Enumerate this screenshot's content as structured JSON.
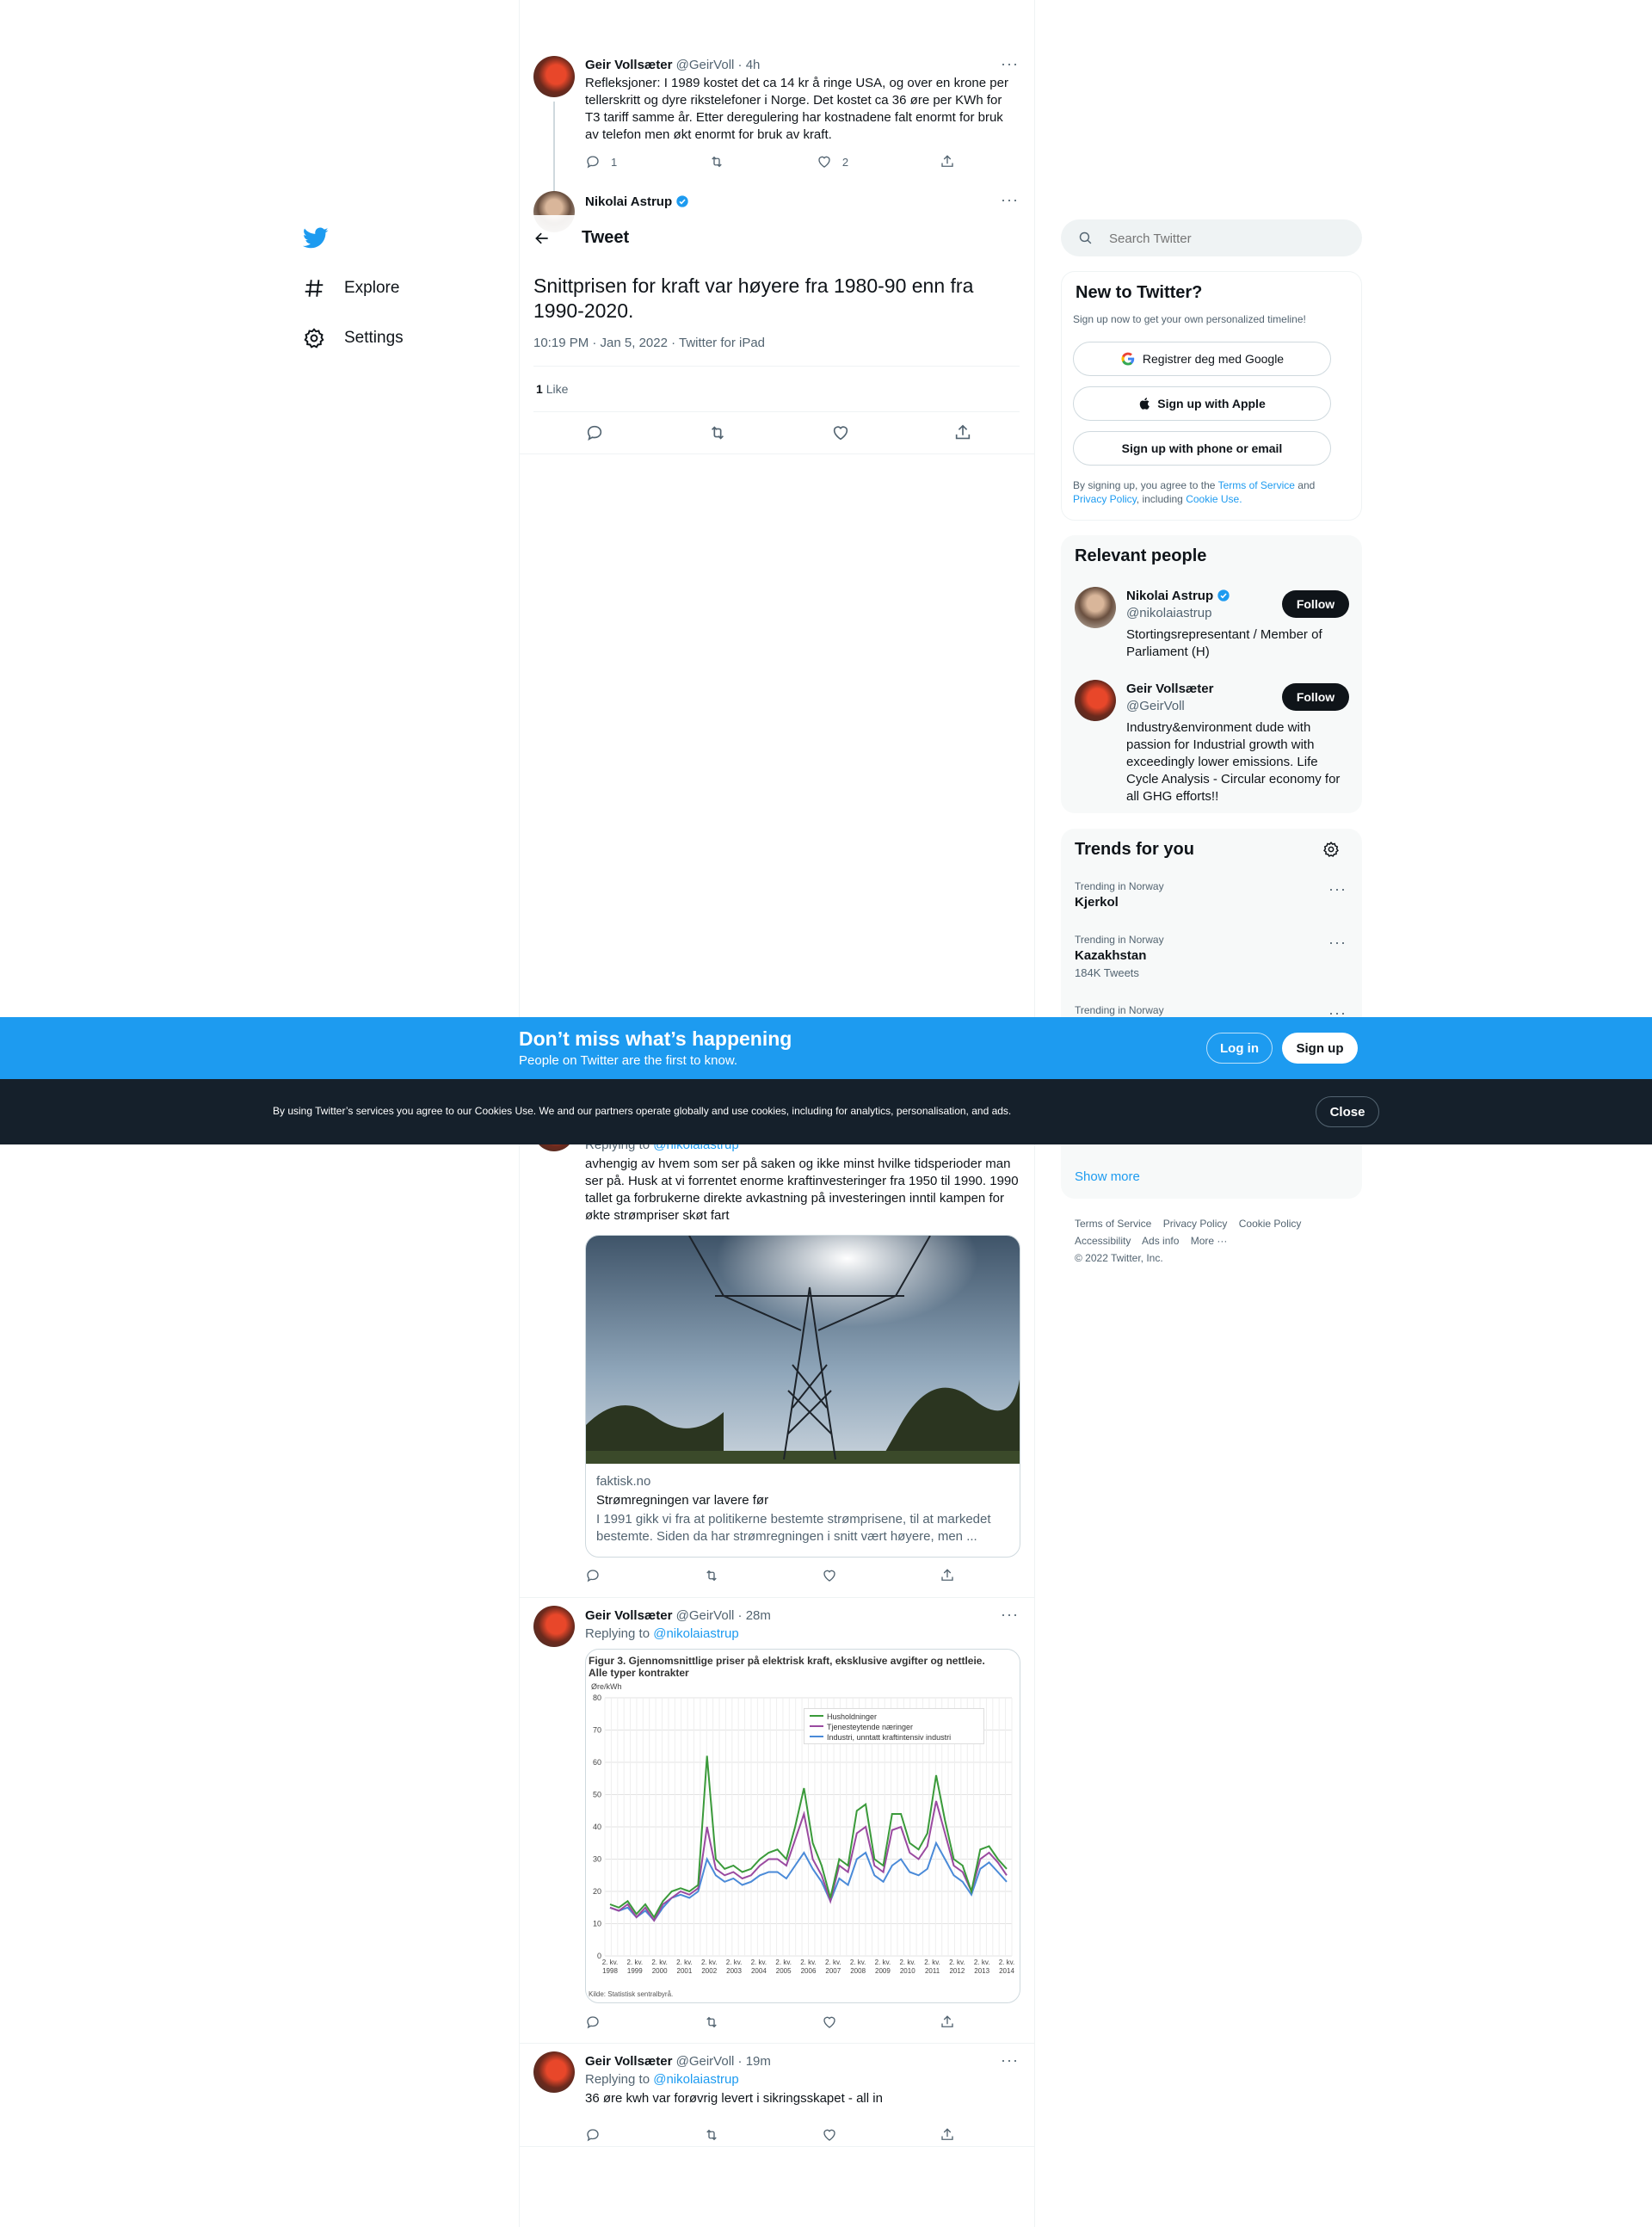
{
  "nav": {
    "explore": "Explore",
    "settings": "Settings"
  },
  "header": {
    "title": "Tweet"
  },
  "thread": {
    "parent": {
      "name": "Geir Vollsæter",
      "handle": "@GeirVoll",
      "time": "· 4h",
      "text": "Refleksjoner: I 1989 kostet det ca 14 kr å ringe USA, og over en krone per tellerskritt og dyre rikstelefoner i Norge. Det kostet ca 36 øre per KWh for T3 tariff samme år.  Etter deregulering har kostnadene falt enormt for bruk av telefon men økt enormt for bruk av kraft.",
      "replies": "1",
      "likes": "2"
    },
    "main": {
      "name": "Nikolai Astrup",
      "text": "Snittprisen for kraft var høyere fra 1980-90 enn fra 1990-2020.",
      "meta": "10:19 PM · Jan 5, 2022 · Twitter for iPad",
      "likes_count": "1",
      "likes_label": "Like"
    }
  },
  "replies": [
    {
      "reply_to_label": "Replying to",
      "reply_to": "@nikolaiastrup",
      "text": "avhengig av hvem som ser på saken og ikke minst hvilke tidsperioder man ser på. Husk at vi forrentet enorme kraftinvesteringer fra 1950 til 1990. 1990 tallet ga forbrukerne direkte avkastning på investeringen inntil kampen for økte strømpriser skøt fart",
      "card": {
        "domain": "faktisk.no",
        "title": "Strømregningen var lavere før",
        "description": "I 1991 gikk vi fra at politikerne bestemte strømprisene, til at markedet bestemte. Siden da har strømregningen i snitt vært høyere, men ..."
      }
    },
    {
      "name": "Geir Vollsæter",
      "handle": "@GeirVoll",
      "time": "· 28m",
      "reply_to_label": "Replying to",
      "reply_to": "@nikolaiastrup"
    },
    {
      "name": "Geir Vollsæter",
      "handle": "@GeirVoll",
      "time": "· 19m",
      "reply_to_label": "Replying to",
      "reply_to": "@nikolaiastrup",
      "text": "36  øre kwh var forøvrig levert i sikringsskapet  - all in"
    }
  ],
  "chart_image": {
    "title_line1": "Figur 3. Gjennomsnittlige priser på elektrisk kraft, eksklusive avgifter og nettleie.",
    "title_line2": "Alle typer kontrakter",
    "unit": "Øre/kWh",
    "source": "Kilde: Statistisk sentralbyrå.",
    "legend": [
      "Husholdninger",
      "Tjenesteytende næringer",
      "Industri, unntatt kraftintensiv industri"
    ],
    "y_ticks": [
      "80",
      "70",
      "60",
      "50",
      "40",
      "30",
      "20",
      "10",
      "0"
    ],
    "x_ticks": [
      "2. kv.\n1998",
      "2. kv.\n1999",
      "2. kv.\n2000",
      "2. kv.\n2001",
      "2. kv.\n2002",
      "2. kv.\n2003",
      "2. kv.\n2004",
      "2. kv.\n2005",
      "2. kv.\n2006",
      "2. kv.\n2007",
      "2. kv.\n2008",
      "2. kv.\n2009",
      "2. kv.\n2010",
      "2. kv.\n2011",
      "2. kv.\n2012",
      "2. kv.\n2013",
      "2. kv.\n2014"
    ]
  },
  "search": {
    "placeholder": "Search Twitter"
  },
  "new_to_twitter": {
    "title": "New to Twitter?",
    "subtitle": "Sign up now to get your own personalized timeline!",
    "google": "Registrer deg med Google",
    "apple": "Sign up with Apple",
    "phone": "Sign up with phone or email",
    "legal_prefix": "By signing up, you agree to the",
    "terms": "Terms of Service",
    "and": "and",
    "privacy": "Privacy Policy",
    "including": ", including",
    "cookie": "Cookie Use."
  },
  "relevant_people": {
    "title": "Relevant people",
    "follow_label": "Follow",
    "people": [
      {
        "name": "Nikolai Astrup",
        "handle": "@nikolaiastrup",
        "bio": "Stortingsrepresentant / Member of Parliament (H)"
      },
      {
        "name": "Geir Vollsæter",
        "handle": "@GeirVoll",
        "bio": "Industry&environment dude with passion for Industrial growth with exceedingly lower emissions. Life Cycle Analysis - Circular economy for all GHG efforts!!"
      }
    ]
  },
  "trends": {
    "title": "Trends for you",
    "items": [
      {
        "context": "Trending in Norway",
        "name": "Kjerkol",
        "count": ""
      },
      {
        "context": "Trending in Norway",
        "name": "Kazakhstan",
        "count": "184K Tweets"
      },
      {
        "context": "Trending in Norway",
        "name": "",
        "count": ""
      }
    ],
    "show_more": "Show more"
  },
  "footer": {
    "links": [
      "Terms of Service",
      "Privacy Policy",
      "Cookie Policy",
      "Accessibility",
      "Ads info",
      "More ···"
    ],
    "copyright": "© 2022 Twitter, Inc."
  },
  "signup_banner": {
    "title": "Don’t miss what’s happening",
    "subtitle": "People on Twitter are the first to know.",
    "login": "Log in",
    "signup": "Sign up"
  },
  "cookie_banner": {
    "text": "By using Twitter’s services you agree to our Cookies Use. We and our partners operate globally and use cookies, including for analytics, personalisation, and ads.",
    "close": "Close"
  },
  "colors": {
    "accent": "#1d9bf0",
    "dark": "#15202b",
    "series_households": "#3a9a3a",
    "series_services": "#9a4aa0",
    "series_industry": "#4a8ad8"
  }
}
